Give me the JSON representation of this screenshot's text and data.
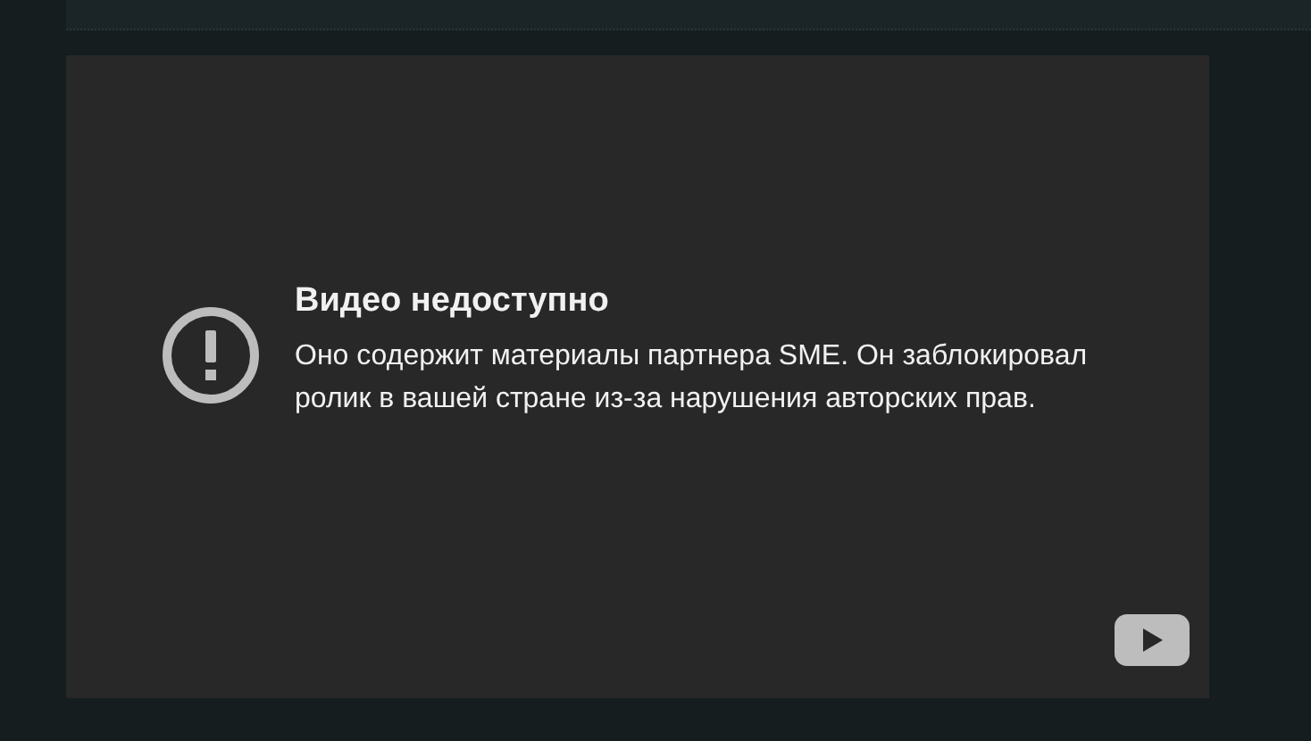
{
  "player": {
    "error_title": "Видео недоступно",
    "error_message": "Оно содержит материалы партнера SME. Он заблокировал ролик в вашей стране из-за нарушения авторских прав."
  }
}
